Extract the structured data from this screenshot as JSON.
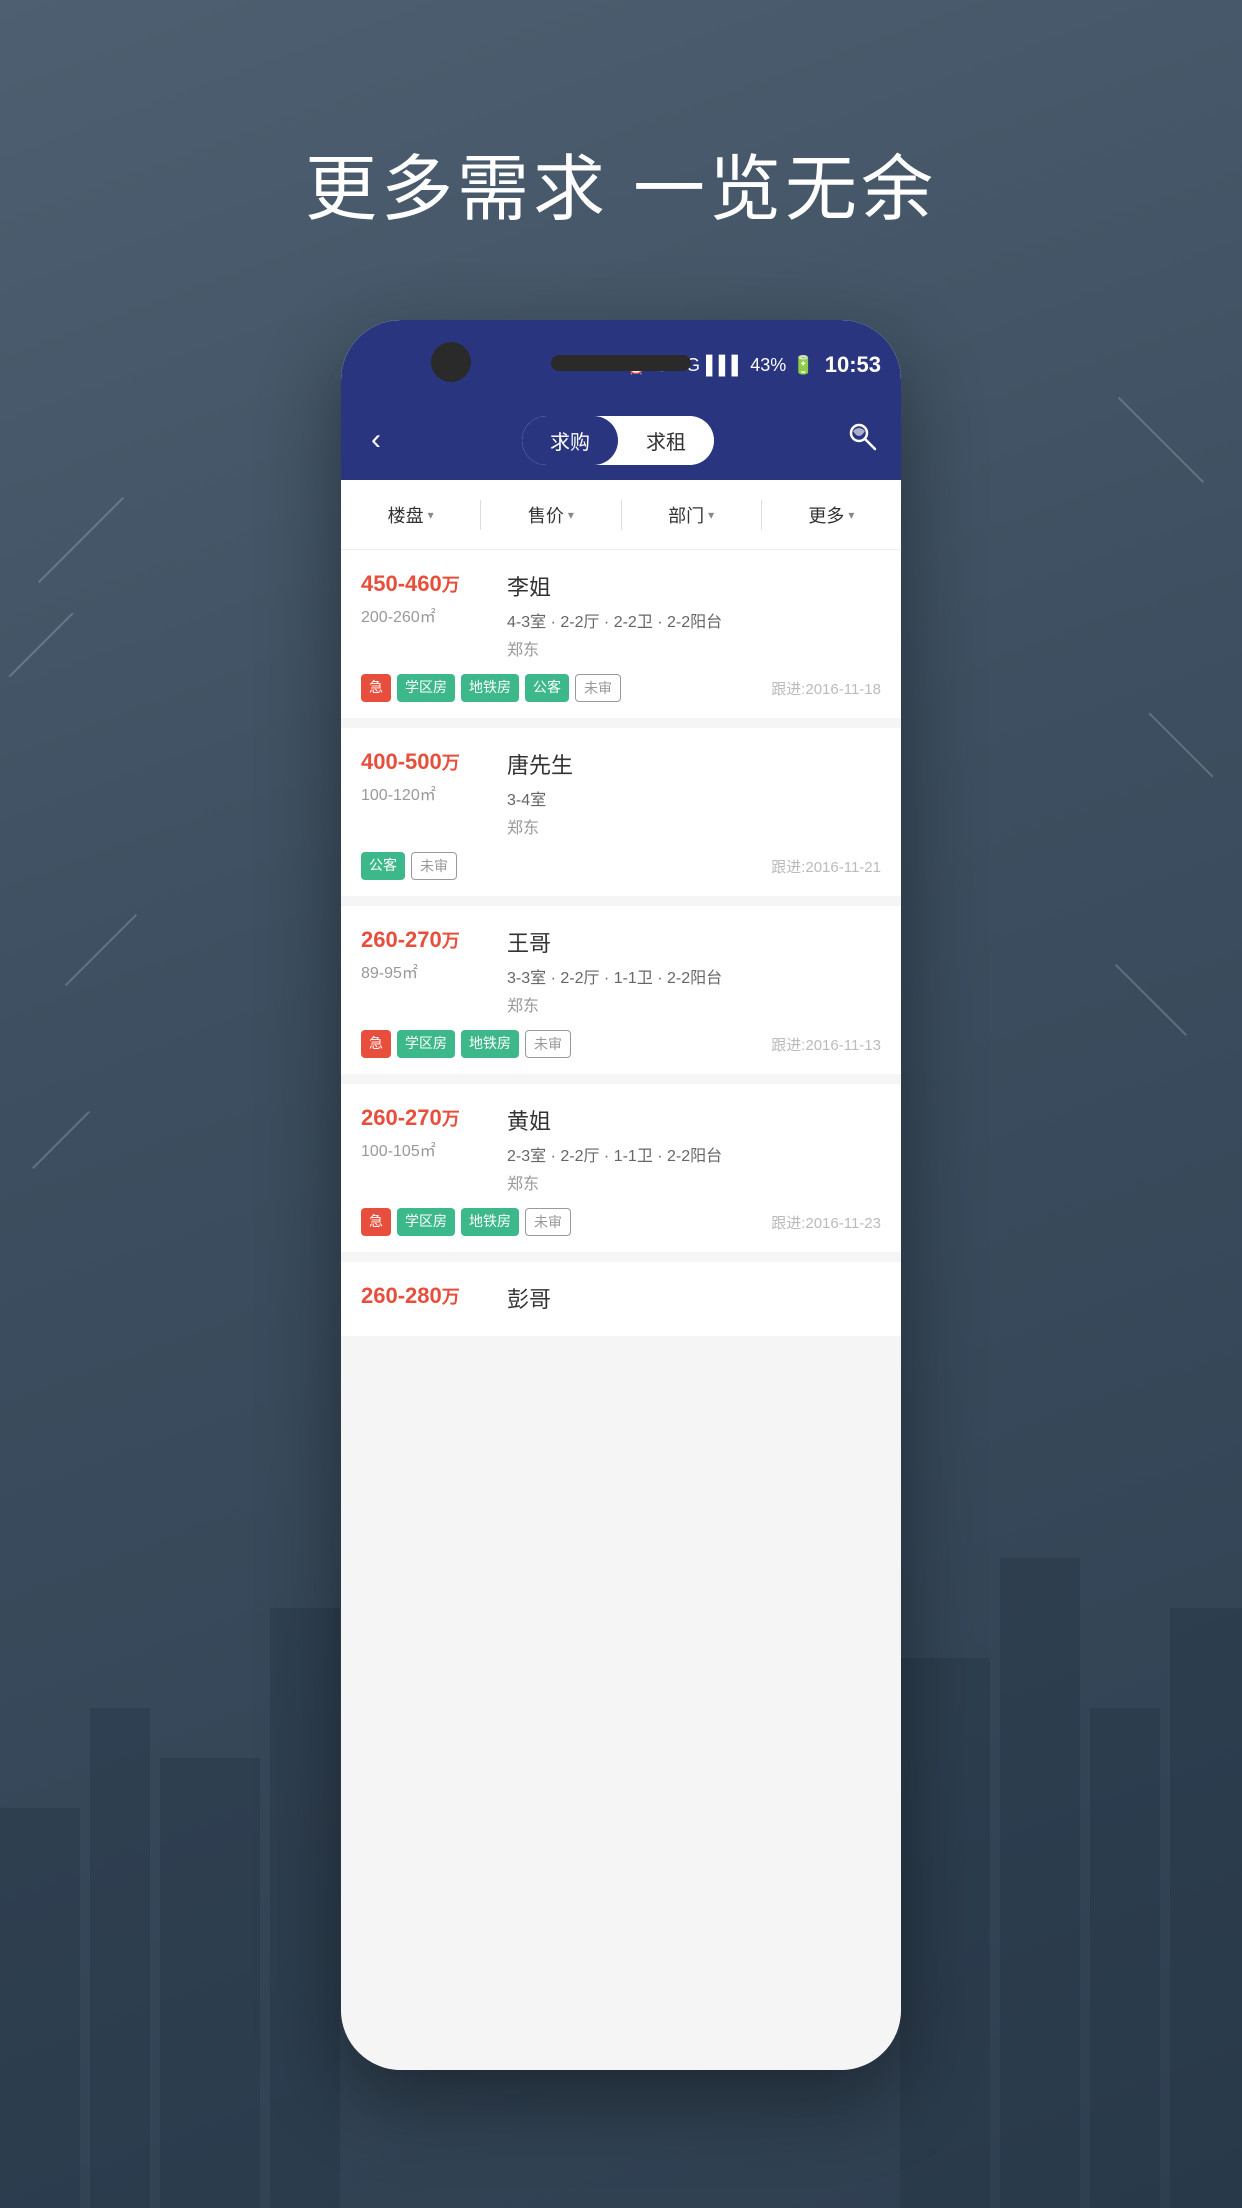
{
  "background": {
    "color": "#4a5a6b"
  },
  "page_title": "更多需求 一览无余",
  "status_bar": {
    "battery": "43%",
    "time": "10:53",
    "signal": "4G",
    "network": "1"
  },
  "nav": {
    "back_label": "‹",
    "tab_buy": "求购",
    "tab_rent": "求租",
    "map_icon": "map"
  },
  "filters": [
    {
      "label": "楼盘",
      "key": "building"
    },
    {
      "label": "售价",
      "key": "price"
    },
    {
      "label": "部门",
      "key": "dept"
    },
    {
      "label": "更多",
      "key": "more"
    }
  ],
  "listings": [
    {
      "price": "450-460",
      "price_unit": "万",
      "area": "200-260㎡",
      "name": "李姐",
      "details": "4-3室 · 2-2厅 · 2-2卫 · 2-2阳台",
      "location": "郑东",
      "tags": [
        "急",
        "学区房",
        "地铁房",
        "公客",
        "未审"
      ],
      "tag_types": [
        "urgent",
        "school",
        "metro",
        "public",
        "pending"
      ],
      "follow_date": "跟进:2016-11-18"
    },
    {
      "price": "400-500",
      "price_unit": "万",
      "area": "100-120㎡",
      "name": "唐先生",
      "details": "3-4室",
      "location": "郑东",
      "tags": [
        "公客",
        "未审"
      ],
      "tag_types": [
        "public",
        "pending"
      ],
      "follow_date": "跟进:2016-11-21"
    },
    {
      "price": "260-270",
      "price_unit": "万",
      "area": "89-95㎡",
      "name": "王哥",
      "details": "3-3室 · 2-2厅 · 1-1卫 · 2-2阳台",
      "location": "郑东",
      "tags": [
        "急",
        "学区房",
        "地铁房",
        "未审"
      ],
      "tag_types": [
        "urgent",
        "school",
        "metro",
        "pending"
      ],
      "follow_date": "跟进:2016-11-13"
    },
    {
      "price": "260-270",
      "price_unit": "万",
      "area": "100-105㎡",
      "name": "黄姐",
      "details": "2-3室 · 2-2厅 · 1-1卫 · 2-2阳台",
      "location": "郑东",
      "tags": [
        "急",
        "学区房",
        "地铁房",
        "未审"
      ],
      "tag_types": [
        "urgent",
        "school",
        "metro",
        "pending"
      ],
      "follow_date": "跟进:2016-11-23"
    },
    {
      "price": "260-280",
      "price_unit": "万",
      "area": "",
      "name": "彭哥",
      "details": "",
      "location": "",
      "tags": [],
      "tag_types": [],
      "follow_date": ""
    }
  ]
}
